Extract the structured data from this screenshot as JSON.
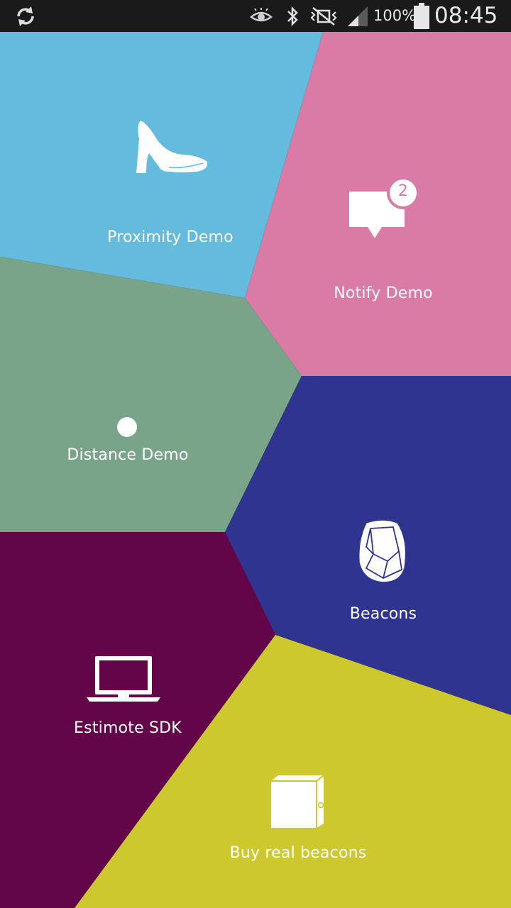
{
  "status_bar": {
    "sync_icon": "sync-icon",
    "eye_icon": "smart-stay-eye-icon",
    "bluetooth_icon": "bluetooth-icon",
    "mute_icon": "vibrate-mute-icon",
    "signal_icon": "signal-icon",
    "battery_percent": "100%",
    "battery_icon": "battery-icon",
    "time": "08:45"
  },
  "colors": {
    "proximity": "#65bbde",
    "notify": "#d97ba4",
    "distance": "#7aa48a",
    "beacons": "#2f3490",
    "sdk": "#620649",
    "buy": "#cdc82e"
  },
  "tiles": {
    "proximity": {
      "label": "Proximity Demo",
      "icon": "high-heel-shoe-icon"
    },
    "notify": {
      "label": "Notify Demo",
      "icon": "notification-bubble-icon",
      "badge": "2"
    },
    "distance": {
      "label": "Distance Demo",
      "icon": "dot-icon"
    },
    "beacons": {
      "label": "Beacons",
      "icon": "beacon-stone-icon"
    },
    "sdk": {
      "label": "Estimote SDK",
      "icon": "laptop-icon"
    },
    "buy": {
      "label": "Buy real beacons",
      "icon": "box-icon"
    }
  }
}
